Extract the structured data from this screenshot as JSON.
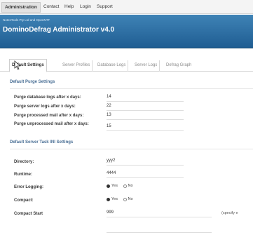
{
  "topnav": {
    "items": [
      "Administration",
      "Contact",
      "Help",
      "Login",
      "Support"
    ]
  },
  "banner": {
    "small_text": "NotesTools Pty Ltd and OpenNTF",
    "title": "DominoDefrag Administrator v4.0"
  },
  "tabs": [
    {
      "label": "Default Settings",
      "active": true
    },
    {
      "label": "Server Profiles",
      "active": false
    },
    {
      "label": "Database Logs",
      "active": false
    },
    {
      "label": "Server Logs",
      "active": false
    },
    {
      "label": "Defrag Graph",
      "active": false
    }
  ],
  "purge": {
    "heading": "Default Purge Settings",
    "rows": [
      {
        "label": "Purge database logs after x days:",
        "value": "14"
      },
      {
        "label": "Purge server logs after x days:",
        "value": "22"
      },
      {
        "label": "Purge processed mail after x days:",
        "value": "13"
      },
      {
        "label": "Purge unprocessed mail after x days:",
        "value": "15"
      }
    ]
  },
  "server": {
    "heading": "Default Server Task INI Settings",
    "directory": {
      "label": "Directory:",
      "value": "yyy2"
    },
    "runtime": {
      "label": "Runtime:",
      "value": "4444"
    },
    "error_logging": {
      "label": "Error Logging:",
      "yes": "Yes",
      "no": "No",
      "selected": "Yes"
    },
    "compact": {
      "label": "Compact:",
      "yes": "Yes",
      "no": "No",
      "selected": "Yes"
    },
    "compact_start": {
      "label": "Compact Start",
      "value": "999",
      "note": "(specify e"
    }
  }
}
